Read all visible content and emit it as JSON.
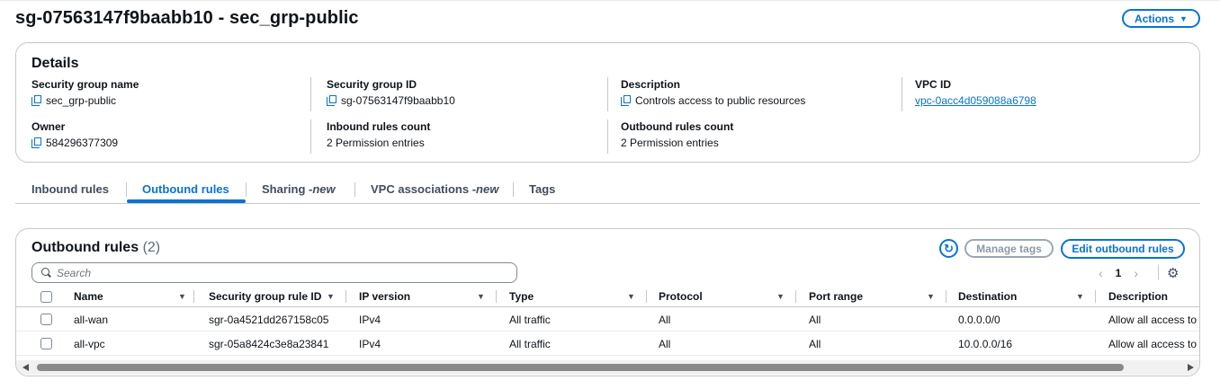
{
  "header": {
    "title": "sg-07563147f9baabb10 - sec_grp-public",
    "actions_label": "Actions"
  },
  "details": {
    "title": "Details",
    "security_group_name_label": "Security group name",
    "security_group_name": "sec_grp-public",
    "security_group_id_label": "Security group ID",
    "security_group_id": "sg-07563147f9baabb10",
    "description_label": "Description",
    "description": "Controls access to public resources",
    "vpc_id_label": "VPC ID",
    "vpc_id": "vpc-0acc4d059088a6798",
    "owner_label": "Owner",
    "owner": "584296377309",
    "inbound_count_label": "Inbound rules count",
    "inbound_count": "2 Permission entries",
    "outbound_count_label": "Outbound rules count",
    "outbound_count": "2 Permission entries"
  },
  "tabs": [
    {
      "label": "Inbound rules",
      "suffix": ""
    },
    {
      "label": "Outbound rules",
      "suffix": ""
    },
    {
      "label": "Sharing - ",
      "suffix": "new"
    },
    {
      "label": "VPC associations - ",
      "suffix": "new"
    },
    {
      "label": "Tags",
      "suffix": ""
    }
  ],
  "active_tab": "Outbound rules",
  "rules": {
    "title": "Outbound rules",
    "count": "(2)",
    "manage_tags_label": "Manage tags",
    "edit_label": "Edit outbound rules",
    "search_placeholder": "Search",
    "page": "1",
    "columns": [
      "Name",
      "Security group rule ID",
      "IP version",
      "Type",
      "Protocol",
      "Port range",
      "Destination",
      "Description"
    ],
    "rows": [
      [
        "all-wan",
        "sgr-0a4521dd267158c05",
        "IPv4",
        "All traffic",
        "All",
        "All",
        "0.0.0.0/0",
        "Allow all access to W"
      ],
      [
        "all-vpc",
        "sgr-05a8424c3e8a23841",
        "IPv4",
        "All traffic",
        "All",
        "All",
        "10.0.0.0/16",
        "Allow all access to V"
      ]
    ]
  },
  "colors": {
    "accent": "#0972d3",
    "border": "#c6c6cd",
    "text": "#0f141a",
    "disabled": "#8d99a8"
  },
  "icons": [
    "copy-icon",
    "refresh-icon",
    "search-icon",
    "chevron-left-icon",
    "chevron-right-icon",
    "settings-icon",
    "sort-icon",
    "caret-down-icon"
  ]
}
